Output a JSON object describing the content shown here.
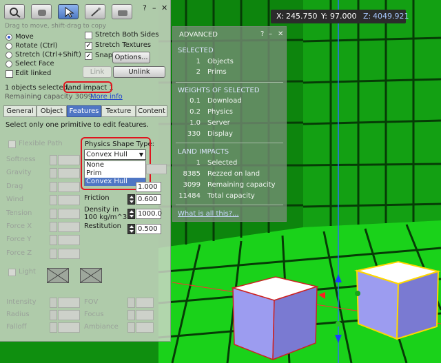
{
  "coords": {
    "x_label": "X:",
    "x_value": "245.750",
    "y_label": "Y:",
    "y_value": "97.000",
    "z_label": "Z:",
    "z_value": "4049.921"
  },
  "build": {
    "close_controls": {
      "help": "?",
      "minimize": "–",
      "close": "✕"
    },
    "hint": "Drag to move, shift-drag to copy",
    "modes": [
      {
        "label": "Move",
        "selected": true
      },
      {
        "label": "Rotate (Ctrl)",
        "selected": false
      },
      {
        "label": "Stretch (Ctrl+Shift)",
        "selected": false
      },
      {
        "label": "Select Face",
        "selected": false
      }
    ],
    "edit_linked": "Edit linked",
    "stretch_both_sides": "Stretch Both Sides",
    "stretch_textures": "Stretch Textures",
    "snap": "Snap",
    "options_button": "Options...",
    "link_button": "Link",
    "unlink_button": "Unlink",
    "objects_selected": "1 objects selected,",
    "land_impact": "land impact 1",
    "remaining": "Remaining capacity 3099.",
    "more_info": "More info",
    "tabs": [
      "General",
      "Object",
      "Features",
      "Texture",
      "Content"
    ],
    "selected_tab": "Features",
    "select_prompt": "Select only one primitive to edit features.",
    "flexible_path": "Flexible Path",
    "physics_shape_label": "Physics Shape Type:",
    "physics_shape_value": "Convex Hull",
    "physics_options": [
      "None",
      "Prim",
      "Convex Hull"
    ],
    "flex_labels": [
      "Softness",
      "Gravity",
      "Drag",
      "Wind",
      "Tension",
      "Force X",
      "Force Y",
      "Force Z"
    ],
    "friction_label": "Friction",
    "friction_value": "0.600",
    "density_label_1": "Density in",
    "density_label_2": "100 kg/m^3",
    "density_value": "1000.0",
    "restitution_label": "Restitution",
    "restitution_value": "0.500",
    "gravity_value": "1.000",
    "light_label": "Light",
    "light_labels_left": [
      "Intensity",
      "Radius",
      "Falloff"
    ],
    "light_labels_right": [
      "FOV",
      "Focus",
      "Ambiance"
    ]
  },
  "advanced": {
    "title": "ADVANCED",
    "controls": {
      "help": "?",
      "minimize": "–",
      "close": "✕"
    },
    "selected_header": "SELECTED",
    "selected_rows": [
      {
        "num": "1",
        "label": "Objects"
      },
      {
        "num": "2",
        "label": "Prims"
      }
    ],
    "weights_header": "WEIGHTS OF SELECTED",
    "weights_rows": [
      {
        "num": "0.1",
        "label": "Download"
      },
      {
        "num": "0.2",
        "label": "Physics"
      },
      {
        "num": "1.0",
        "label": "Server"
      },
      {
        "num": "330",
        "label": "Display"
      }
    ],
    "impacts_header": "LAND IMPACTS",
    "impacts_rows": [
      {
        "num": "1",
        "label": "Selected"
      },
      {
        "num": "8385",
        "label": "Rezzed on land"
      },
      {
        "num": "3099",
        "label": "Remaining capacity"
      },
      {
        "num": "11484",
        "label": "Total capacity"
      }
    ],
    "link": "What is all this?..."
  },
  "colors": {
    "ground": "#19d219",
    "wall": "#0e8a0e",
    "accent": "#4f76c4",
    "highlight_red": "#e0141e"
  }
}
